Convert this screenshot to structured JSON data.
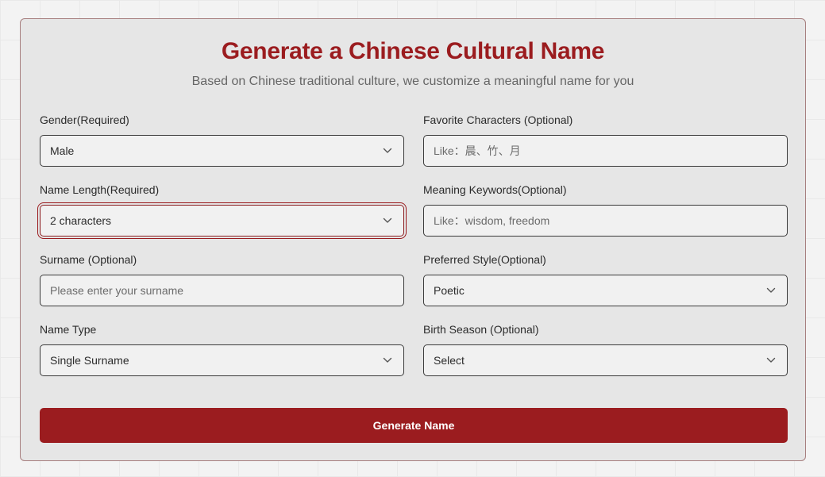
{
  "header": {
    "title": "Generate a Chinese Cultural Name",
    "subtitle": "Based on Chinese traditional culture, we customize a meaningful name for you"
  },
  "fields": {
    "gender": {
      "label": "Gender(Required)",
      "value": "Male"
    },
    "favorite_characters": {
      "label": "Favorite Characters (Optional)",
      "placeholder": "Like：晨、竹、月"
    },
    "name_length": {
      "label": "Name Length(Required)",
      "value": "2 characters"
    },
    "meaning_keywords": {
      "label": "Meaning Keywords(Optional)",
      "placeholder": "Like：wisdom, freedom"
    },
    "surname": {
      "label": "Surname (Optional)",
      "placeholder": "Please enter your surname"
    },
    "preferred_style": {
      "label": "Preferred Style(Optional)",
      "value": "Poetic"
    },
    "name_type": {
      "label": "Name Type",
      "value": "Single Surname"
    },
    "birth_season": {
      "label": "Birth Season (Optional)",
      "value": "Select"
    }
  },
  "actions": {
    "generate_label": "Generate Name"
  },
  "icons": {
    "select_chevron": "chevron-down-icon"
  },
  "colors": {
    "accent": "#9b1c1f",
    "card_background": "#e6e6e6",
    "page_background": "#f3f3f3"
  }
}
